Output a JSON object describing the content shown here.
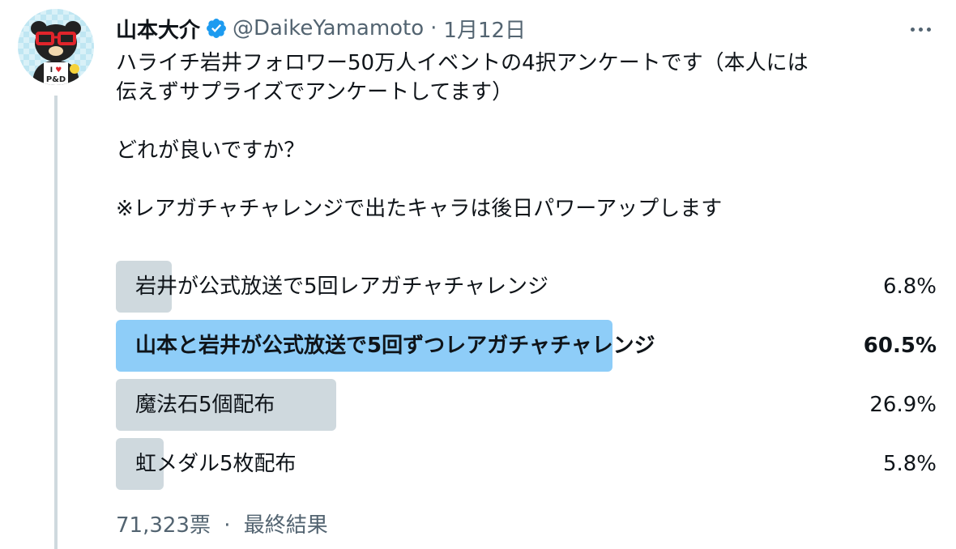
{
  "author": {
    "display_name": "山本大介",
    "handle": "@DaikeYamamoto",
    "date": "1月12日",
    "separator": "·",
    "verified_color": "#1d9bf0",
    "avatar_icon": "bear-avatar-icon",
    "avatar_badge_text": "I ♥ P&D"
  },
  "tweet": {
    "line1": "ハライチ岩井フォロワー50万人イベントの4択アンケートです（本人には",
    "line2": "伝えずサプライズでアンケートしてます）",
    "line3": "どれが良いですか？",
    "line4": "※レアガチャチャレンジで出たキャラは後日パワーアップします"
  },
  "poll": {
    "options": [
      {
        "label": "岩井が公式放送で5回レアガチャチャレンジ",
        "percent_text": "6.8%",
        "percent": 6.8,
        "winner": false
      },
      {
        "label": "山本と岩井が公式放送で5回ずつレアガチャチャレンジ",
        "percent_text": "60.5%",
        "percent": 60.5,
        "winner": true
      },
      {
        "label": "魔法石5個配布",
        "percent_text": "26.9%",
        "percent": 26.9,
        "winner": false
      },
      {
        "label": "虹メダル5枚配布",
        "percent_text": "5.8%",
        "percent": 5.8,
        "winner": false
      }
    ],
    "votes": "71,323票",
    "separator": "·",
    "status": "最終結果",
    "bar_color": "#cfd9de",
    "winner_bar_color": "#8ecdf8"
  }
}
